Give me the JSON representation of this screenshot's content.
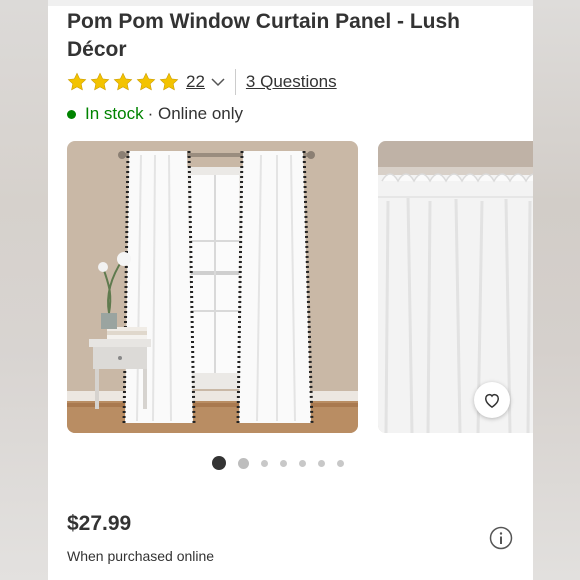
{
  "product": {
    "title": "Pom Pom Window Curtain Panel - Lush Décor",
    "rating": 5,
    "review_count": "22",
    "questions": "3 Questions",
    "stock_status": "In stock",
    "availability": "· Online only"
  },
  "gallery": {
    "total_images": 7,
    "active_index": 0
  },
  "pricing": {
    "price": "$27.99",
    "note": "When purchased online"
  },
  "colors": {
    "in_stock_green": "#008300",
    "star_yellow": "#f3c300",
    "text_dark": "#333333"
  },
  "icons": [
    "star-icon",
    "chevron-down-icon",
    "heart-icon",
    "info-icon"
  ]
}
